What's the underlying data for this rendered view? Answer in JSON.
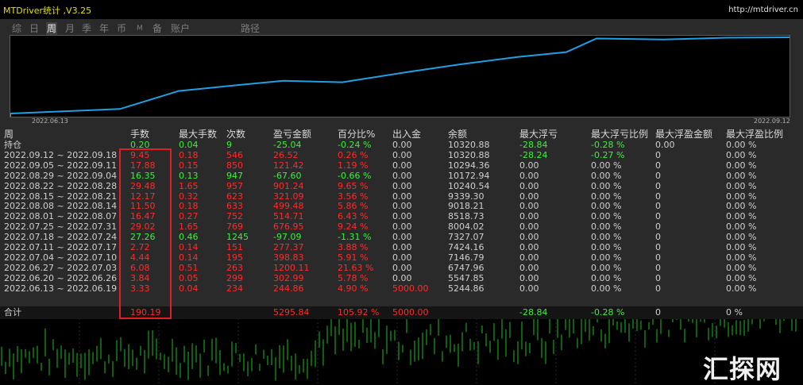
{
  "window": {
    "title": "MTDriver统计 ,V3.25",
    "link": "http://mtdriver.cn"
  },
  "tabs": [
    "综",
    "日",
    "周",
    "月",
    "季",
    "年",
    "币",
    "M",
    "备",
    "账户",
    "路径"
  ],
  "active_tab": 2,
  "equity_chart": {
    "start_date": "2022.06.13",
    "end_date": "2022.09.12",
    "line_color": "#1ea0e8",
    "balance": [
      5244.86,
      5547.85,
      6747.96,
      7146.79,
      7424.16,
      7327.07,
      8004.02,
      8518.73,
      9018.21,
      9339.3,
      10240.54,
      10172.94,
      10294.36,
      10320.88
    ]
  },
  "table": {
    "headers": [
      "周",
      "手数",
      "最大手数",
      "次数",
      "盈亏金额",
      "百分比%",
      "出入金",
      "余额",
      "最大浮亏",
      "最大浮亏比例",
      "最大浮盈金额",
      "最大浮盈比例"
    ],
    "rows": [
      {
        "period": "持仓",
        "lots": "0.20",
        "max_lots": "0.04",
        "count": "9",
        "pnl": "-25.04",
        "pct": "-0.24 %",
        "flow": "0.00",
        "balance": "10320.88",
        "max_dd": "-28.84",
        "max_dd_pct": "-0.28 %",
        "max_fp": "0.00",
        "max_fp_pct": "0.00 %",
        "sign": "neg"
      },
      {
        "period": "2022.09.12 ~ 2022.09.18",
        "lots": "9.45",
        "max_lots": "0.18",
        "count": "546",
        "pnl": "26.52",
        "pct": "0.26 %",
        "flow": "0.00",
        "balance": "10320.88",
        "max_dd": "-28.24",
        "max_dd_pct": "-0.27 %",
        "max_fp": "0",
        "max_fp_pct": "0.00 %",
        "sign": "pos"
      },
      {
        "period": "2022.09.05 ~ 2022.09.11",
        "lots": "17.88",
        "max_lots": "0.15",
        "count": "850",
        "pnl": "121.42",
        "pct": "1.19 %",
        "flow": "0.00",
        "balance": "10294.36",
        "max_dd": "0.00",
        "max_dd_pct": "0.00 %",
        "max_fp": "0",
        "max_fp_pct": "0.00 %",
        "sign": "pos"
      },
      {
        "period": "2022.08.29 ~ 2022.09.04",
        "lots": "16.35",
        "max_lots": "0.13",
        "count": "947",
        "pnl": "-67.60",
        "pct": "-0.66 %",
        "flow": "0.00",
        "balance": "10172.94",
        "max_dd": "0.00",
        "max_dd_pct": "0.00 %",
        "max_fp": "0",
        "max_fp_pct": "0.00 %",
        "sign": "neg"
      },
      {
        "period": "2022.08.22 ~ 2022.08.28",
        "lots": "29.48",
        "max_lots": "1.65",
        "count": "957",
        "pnl": "901.24",
        "pct": "9.65 %",
        "flow": "0.00",
        "balance": "10240.54",
        "max_dd": "0.00",
        "max_dd_pct": "0.00 %",
        "max_fp": "0",
        "max_fp_pct": "0.00 %",
        "sign": "pos"
      },
      {
        "period": "2022.08.15 ~ 2022.08.21",
        "lots": "12.17",
        "max_lots": "0.32",
        "count": "623",
        "pnl": "321.09",
        "pct": "3.56 %",
        "flow": "0.00",
        "balance": "9339.30",
        "max_dd": "0.00",
        "max_dd_pct": "0.00 %",
        "max_fp": "0",
        "max_fp_pct": "0.00 %",
        "sign": "pos"
      },
      {
        "period": "2022.08.08 ~ 2022.08.14",
        "lots": "11.50",
        "max_lots": "0.18",
        "count": "633",
        "pnl": "499.48",
        "pct": "5.86 %",
        "flow": "0.00",
        "balance": "9018.21",
        "max_dd": "0.00",
        "max_dd_pct": "0.00 %",
        "max_fp": "0",
        "max_fp_pct": "0.00 %",
        "sign": "pos"
      },
      {
        "period": "2022.08.01 ~ 2022.08.07",
        "lots": "16.47",
        "max_lots": "0.27",
        "count": "752",
        "pnl": "514.71",
        "pct": "6.43 %",
        "flow": "0.00",
        "balance": "8518.73",
        "max_dd": "0.00",
        "max_dd_pct": "0.00 %",
        "max_fp": "0",
        "max_fp_pct": "0.00 %",
        "sign": "pos"
      },
      {
        "period": "2022.07.25 ~ 2022.07.31",
        "lots": "29.02",
        "max_lots": "1.65",
        "count": "769",
        "pnl": "676.95",
        "pct": "9.24 %",
        "flow": "0.00",
        "balance": "8004.02",
        "max_dd": "0.00",
        "max_dd_pct": "0.00 %",
        "max_fp": "0",
        "max_fp_pct": "0.00 %",
        "sign": "pos"
      },
      {
        "period": "2022.07.18 ~ 2022.07.24",
        "lots": "27.26",
        "max_lots": "0.46",
        "count": "1245",
        "pnl": "-97.09",
        "pct": "-1.31 %",
        "flow": "0.00",
        "balance": "7327.07",
        "max_dd": "0.00",
        "max_dd_pct": "0.00 %",
        "max_fp": "0",
        "max_fp_pct": "0.00 %",
        "sign": "neg"
      },
      {
        "period": "2022.07.11 ~ 2022.07.17",
        "lots": "2.72",
        "max_lots": "0.14",
        "count": "151",
        "pnl": "277.37",
        "pct": "3.88 %",
        "flow": "0.00",
        "balance": "7424.16",
        "max_dd": "0.00",
        "max_dd_pct": "0.00 %",
        "max_fp": "0",
        "max_fp_pct": "0.00 %",
        "sign": "pos"
      },
      {
        "period": "2022.07.04 ~ 2022.07.10",
        "lots": "4.44",
        "max_lots": "0.14",
        "count": "195",
        "pnl": "398.83",
        "pct": "5.91 %",
        "flow": "0.00",
        "balance": "7146.79",
        "max_dd": "0.00",
        "max_dd_pct": "0.00 %",
        "max_fp": "0",
        "max_fp_pct": "0.00 %",
        "sign": "pos"
      },
      {
        "period": "2022.06.27 ~ 2022.07.03",
        "lots": "6.08",
        "max_lots": "0.51",
        "count": "263",
        "pnl": "1200.11",
        "pct": "21.63 %",
        "flow": "0.00",
        "balance": "6747.96",
        "max_dd": "0.00",
        "max_dd_pct": "0.00 %",
        "max_fp": "0",
        "max_fp_pct": "0.00 %",
        "sign": "pos"
      },
      {
        "period": "2022.06.20 ~ 2022.06.26",
        "lots": "3.84",
        "max_lots": "0.05",
        "count": "299",
        "pnl": "302.99",
        "pct": "5.78 %",
        "flow": "0.00",
        "balance": "5547.85",
        "max_dd": "0.00",
        "max_dd_pct": "0.00 %",
        "max_fp": "0",
        "max_fp_pct": "0.00 %",
        "sign": "pos"
      },
      {
        "period": "2022.06.13 ~ 2022.06.19",
        "lots": "3.33",
        "max_lots": "0.04",
        "count": "234",
        "pnl": "244.86",
        "pct": "4.90 %",
        "flow": "5000.00",
        "balance": "5244.86",
        "max_dd": "0.00",
        "max_dd_pct": "0.00 %",
        "max_fp": "0",
        "max_fp_pct": "0.00 %",
        "sign": "pos",
        "flow_red": true
      }
    ],
    "total": {
      "label": "合计",
      "lots": "190.19",
      "pnl": "5295.84",
      "pct": "105.92 %",
      "flow": "5000.00",
      "max_dd": "-28.84",
      "max_dd_pct": "-0.28 %",
      "max_fp": "0",
      "max_fp_pct": "0 %"
    }
  },
  "colors": {
    "positive": "#ff2a2a",
    "negative": "#3af03a",
    "highlight_box": "#e02020",
    "candles": "#17c417"
  },
  "watermark": "汇探网"
}
